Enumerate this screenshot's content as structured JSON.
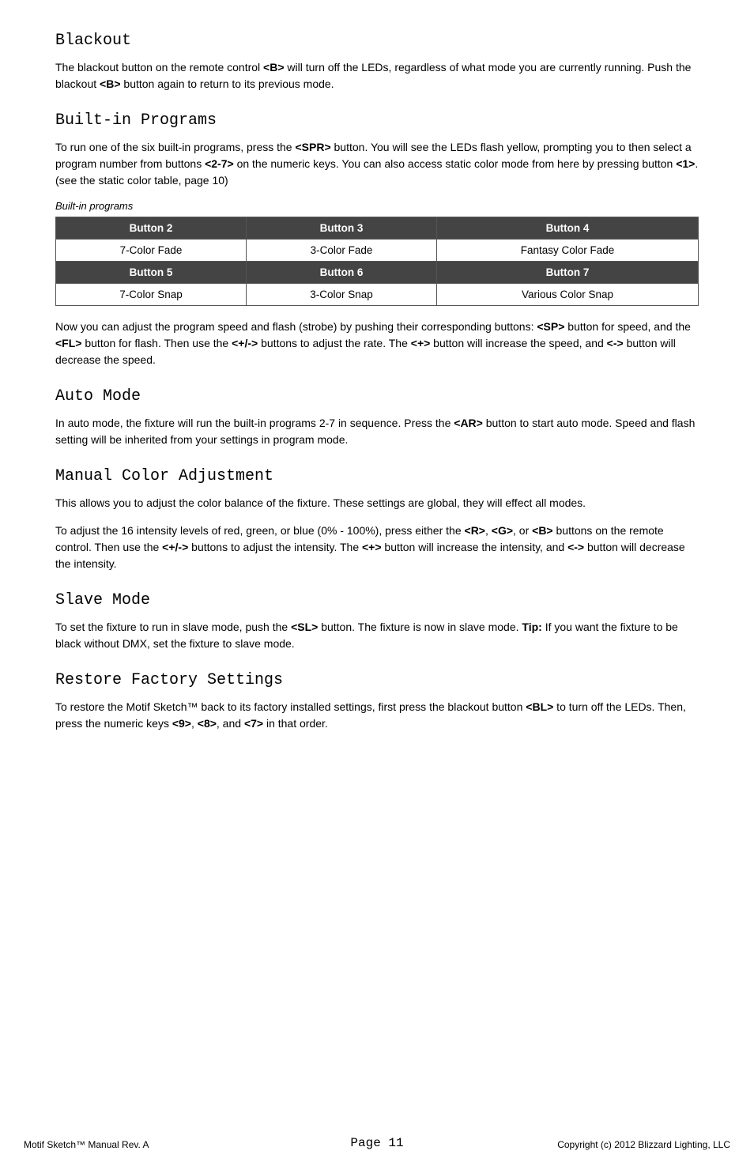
{
  "sections": [
    {
      "id": "blackout",
      "heading": "Blackout",
      "paragraphs": [
        "The blackout button on the remote control <B> will turn off the LEDs, regardless of what mode you are currently running. Push the blackout <B> button again to return to its previous mode."
      ]
    },
    {
      "id": "built-in-programs",
      "heading": "Built-in Programs",
      "paragraphs": [
        "To run one of the six built-in programs, press the <SPR> button. You will see the LEDs flash yellow, prompting you to then select a program number from buttons <2-7> on the numeric keys. You can also access static color mode from here by pressing button <1>. (see the static color table, page 10)"
      ],
      "table_label": "Built-in programs",
      "table": {
        "rows": [
          {
            "type": "header",
            "cells": [
              "Button 2",
              "Button 3",
              "Button 4"
            ]
          },
          {
            "type": "data",
            "cells": [
              "7-Color Fade",
              "3-Color Fade",
              "Fantasy Color Fade"
            ]
          },
          {
            "type": "header",
            "cells": [
              "Button 5",
              "Button 6",
              "Button 7"
            ]
          },
          {
            "type": "data",
            "cells": [
              "7-Color Snap",
              "3-Color Snap",
              "Various Color Snap"
            ]
          }
        ]
      },
      "paragraphs2": [
        "Now you can adjust the program speed and flash (strobe) by pushing their corresponding buttons: <SP> button for speed, and the <FL> button for flash. Then use the <+/-> buttons to adjust the rate. The <+> button will increase the speed, and <-> button will decrease the speed."
      ]
    },
    {
      "id": "auto-mode",
      "heading": "Auto Mode",
      "paragraphs": [
        "In auto mode, the fixture will run the built-in programs 2-7 in sequence. Press the <AR> button to start auto mode. Speed and flash setting will be inherited from your settings in program mode."
      ]
    },
    {
      "id": "manual-color-adjustment",
      "heading": "Manual Color Adjustment",
      "paragraphs": [
        "This allows you to adjust the color balance of the fixture. These settings are global, they will effect all modes.",
        "To adjust the 16 intensity levels of red, green, or blue (0% - 100%), press either the <R>, <G>, or <B> buttons on the remote control. Then use the <+/-> buttons to adjust the intensity. The <+> button will increase the intensity, and <-> button will decrease the intensity."
      ]
    },
    {
      "id": "slave-mode",
      "heading": "Slave Mode",
      "paragraphs": [
        "To set the fixture to run in slave mode, push the <SL> button. The fixture is now in slave mode. Tip: If you want the fixture to be black without DMX, set the fixture to slave mode."
      ]
    },
    {
      "id": "restore-factory-settings",
      "heading": "Restore Factory Settings",
      "paragraphs": [
        "To restore the Motif Sketch™ back to its factory installed settings, first press the blackout button <BL> to turn off the LEDs. Then, press the numeric keys <9>, <8>, and <7> in that order."
      ]
    }
  ],
  "footer": {
    "left": "Motif Sketch™ Manual Rev. A",
    "center": "Page 11",
    "right": "Copyright (c) 2012 Blizzard Lighting, LLC"
  }
}
